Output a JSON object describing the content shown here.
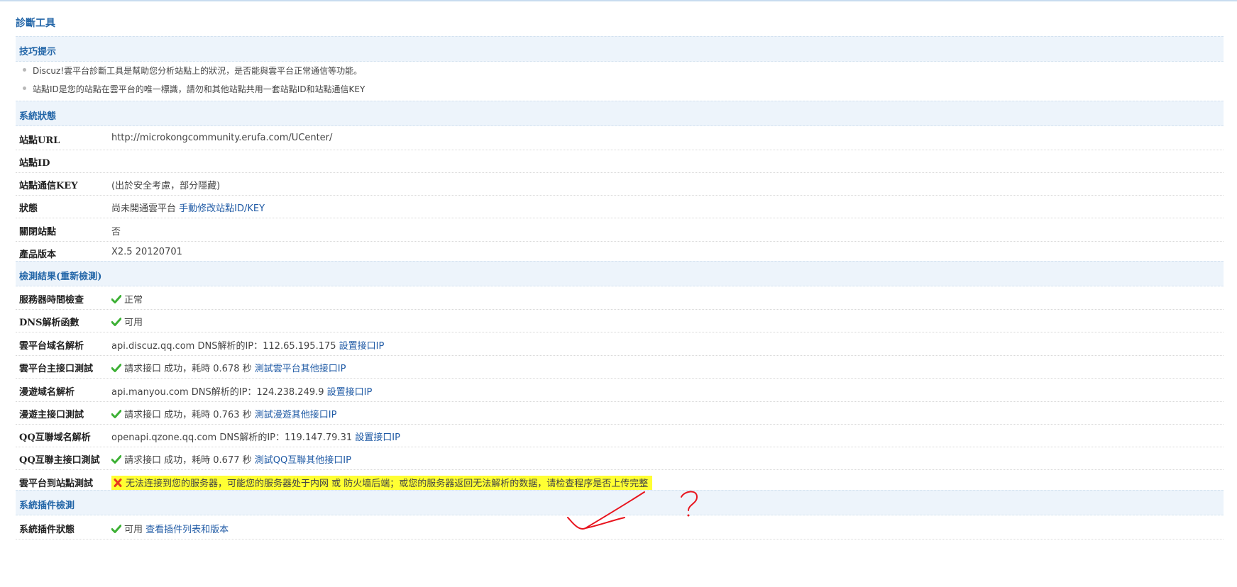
{
  "page_title": "診斷工具",
  "tips": {
    "header": "技巧提示",
    "items": [
      "Discuz!雲平台診斷工具是幫助您分析站點上的狀況，是否能與雲平台正常通信等功能。",
      "站點ID是您的站點在雲平台的唯一標識，請勿和其他站點共用一套站點ID和站點通信KEY"
    ]
  },
  "system_status": {
    "header": "系統狀態",
    "rows": [
      {
        "label": "站點URL",
        "value": "http://microkongcommunity.erufa.com/UCenter/"
      },
      {
        "label": "站點ID",
        "value": ""
      },
      {
        "label": "站點通信KEY",
        "value": "(出於安全考慮，部分隱藏)"
      },
      {
        "label": "狀態",
        "value": "尚未開通雲平台",
        "link": "手動修改站點ID/KEY"
      },
      {
        "label": "關閉站點",
        "value": "否"
      },
      {
        "label": "產品版本",
        "value": "X2.5 20120701"
      }
    ]
  },
  "detect": {
    "header": "檢測結果",
    "header_paren_open": "(",
    "header_link": "重新檢測",
    "header_paren_close": ")",
    "rows": [
      {
        "label": "服務器時間檢查",
        "value": "正常",
        "icon": "check-icon"
      },
      {
        "label": "DNS解析函數",
        "value": "可用",
        "icon": "check-icon"
      },
      {
        "label": "雲平台域名解析",
        "value": "api.discuz.qq.com DNS解析的IP：112.65.195.175",
        "link": "設置接口IP"
      },
      {
        "label": "雲平台主接口測試",
        "value": "請求接口 成功，耗時 0.678 秒",
        "link": "測試雲平台其他接口IP",
        "icon": "check-icon"
      },
      {
        "label": "漫遊域名解析",
        "value": "api.manyou.com DNS解析的IP：124.238.249.9",
        "link": "設置接口IP"
      },
      {
        "label": "漫遊主接口測試",
        "value": "請求接口 成功，耗時 0.763 秒",
        "link": "測試漫遊其他接口IP",
        "icon": "check-icon"
      },
      {
        "label": "QQ互聯域名解析",
        "value": "openapi.qzone.qq.com DNS解析的IP：119.147.79.31",
        "link": "設置接口IP"
      },
      {
        "label": "QQ互聯主接口測試",
        "value": "請求接口 成功，耗時 0.677 秒",
        "link": "測試QQ互聯其他接口IP",
        "icon": "check-icon"
      },
      {
        "label": "雲平台到站點測試",
        "value": "无法连接到您的服务器，可能您的服务器处于内网 或 防火墙后端；或您的服务器返回无法解析的数据，请检查程序是否上传完整",
        "icon": "x-icon",
        "highlight": "#ffff33"
      }
    ]
  },
  "plugins": {
    "header": "系統插件檢測",
    "rows": [
      {
        "label": "系統插件狀態",
        "value": "可用",
        "link": "查看插件列表和版本",
        "icon": "check-icon"
      }
    ]
  },
  "annotation": {
    "mark": "?",
    "color": "#e8141e"
  },
  "colors": {
    "accent": "#2366a8",
    "header_bg": "#edf4fb",
    "link": "#1f5aa5",
    "check": "#3cb034",
    "error": "#e83a1c"
  }
}
